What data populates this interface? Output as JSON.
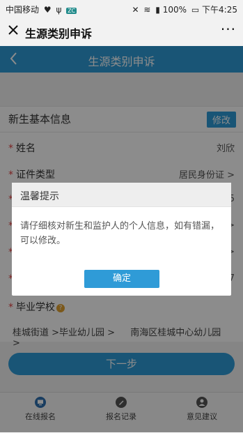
{
  "status": {
    "carrier": "中国移动",
    "battery": "100%",
    "time": "下午4:25"
  },
  "titlebar": {
    "title": "生源类别申诉",
    "more": "···"
  },
  "page": {
    "title": "生源类别申诉"
  },
  "section": {
    "title": "新生基本信息",
    "edit_label": "修改"
  },
  "form": {
    "rows": [
      {
        "label": "姓名",
        "value": "刘欣"
      },
      {
        "label": "证件类型",
        "value": "居民身份证 >"
      },
      {
        "label": "",
        "value": "5"
      },
      {
        "label": "",
        "value": ">"
      },
      {
        "label": "",
        "value": ">"
      },
      {
        "label": "",
        "value": "7"
      }
    ],
    "school_label": "毕业学校",
    "school_street": "桂城街道 >毕业幼儿园 >",
    "school_name": "南海区桂城中心幼儿园 >"
  },
  "next_label": "下一步",
  "nav": [
    {
      "label": "在线报名",
      "icon": "monitor-icon"
    },
    {
      "label": "报名记录",
      "icon": "pen-icon"
    },
    {
      "label": "意见建议",
      "icon": "user-icon"
    }
  ],
  "dialog": {
    "title": "温馨提示",
    "message": "请仔细核对新生和监护人的个人信息，如有错漏，可以修改。",
    "confirm_label": "确定"
  },
  "colors": {
    "accent": "#2f9bd7",
    "required": "#e04040"
  }
}
